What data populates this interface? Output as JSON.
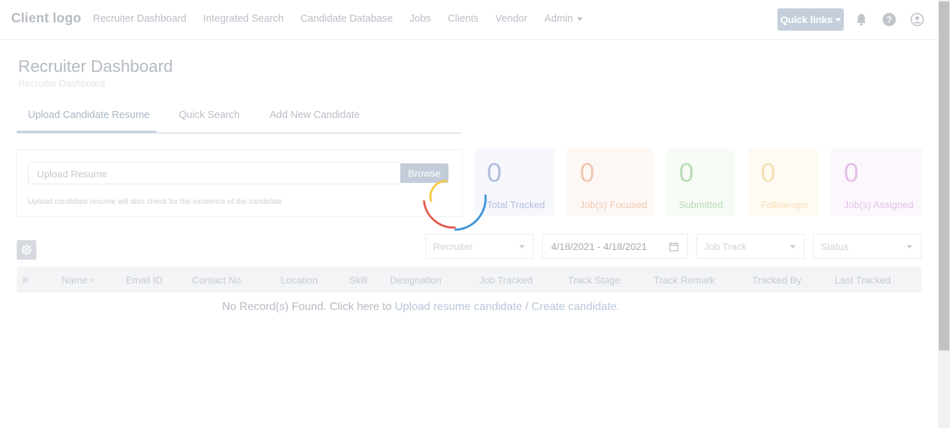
{
  "navbar": {
    "brand": "Client logo",
    "links": [
      "Recruiter Dashboard",
      "Integrated Search",
      "Candidate Database",
      "Jobs",
      "Clients",
      "Vendor",
      "Admin"
    ],
    "quick_links_label": "Quick links",
    "icons": [
      "bell-icon",
      "help-icon",
      "user-icon"
    ]
  },
  "header": {
    "title": "Recruiter Dashboard",
    "breadcrumb": "Recruiter Dashboard"
  },
  "tabs": [
    {
      "label": "Upload Candidate Resume",
      "active": true
    },
    {
      "label": "Quick Search",
      "active": false
    },
    {
      "label": "Add New Candidate",
      "active": false
    }
  ],
  "upload": {
    "placeholder": "Upload Resume",
    "browse_label": "Browse",
    "hint": "Upload candidate resume will also check for the existence of the candidate"
  },
  "stats": [
    {
      "value": "0",
      "label": "Total Tracked",
      "color": "#b1bfd9",
      "bg": "#f6f8fd"
    },
    {
      "value": "0",
      "label": "Job(s) Focused",
      "color": "#f0c7b3",
      "bg": "#fef8f5"
    },
    {
      "value": "0",
      "label": "Submitted",
      "color": "#b9dcb6",
      "bg": "#f6fbf5"
    },
    {
      "value": "0",
      "label": "Follow-ups",
      "color": "#f6dfb6",
      "bg": "#fffaf2"
    },
    {
      "value": "0",
      "label": "Job(s) Assigned",
      "color": "#e3c1e8",
      "bg": "#fcf6fd"
    }
  ],
  "filters": {
    "recruiter": "Recruiter",
    "date_range": "4/18/2021 - 4/18/2021",
    "job_track": "Job Track",
    "status": "Status"
  },
  "table": {
    "columns": [
      "#",
      "Name",
      "Email ID",
      "Contact No.",
      "Location",
      "Skill",
      "Designation",
      "Job Tracked",
      "Track Stage",
      "Track Remark",
      "Tracked By",
      "Last Tracked"
    ],
    "empty_prefix": "No Record(s) Found. Click here to",
    "upload_link": "Upload resume candidate",
    "separator": "/",
    "create_link": "Create candidate."
  },
  "colors": {
    "spinner_red": "#e35a4c",
    "spinner_yellow": "#f4c743",
    "spinner_blue": "#3b95d9"
  }
}
